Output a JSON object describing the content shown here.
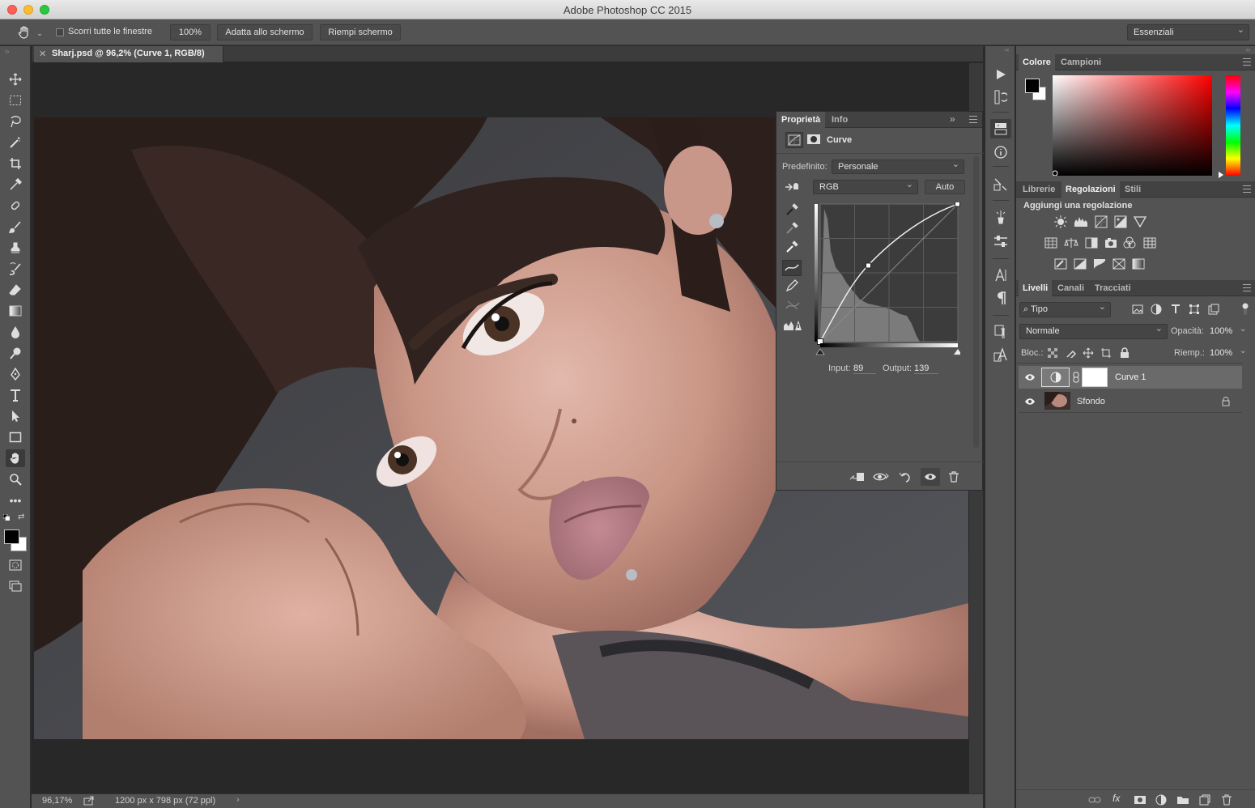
{
  "window": {
    "title": "Adobe Photoshop CC 2015"
  },
  "options_bar": {
    "scroll_all_label": "Scorri tutte le finestre",
    "zoom_btn": "100%",
    "fit_btn": "Adatta allo schermo",
    "fill_btn": "Riempi schermo",
    "workspace": "Essenziali"
  },
  "document": {
    "tab_title": "Sharj.psd @ 96,2% (Curve 1, RGB/8)"
  },
  "status": {
    "zoom": "96,17%",
    "size": "1200 px x 798 px (72 ppl)"
  },
  "properties": {
    "tab_active": "Proprietà",
    "tab_other": "Info",
    "type_label": "Curve",
    "preset_label": "Predefinito:",
    "preset_value": "Personale",
    "channel": "RGB",
    "auto_button": "Auto",
    "input_label": "Input:",
    "input_value": "89",
    "output_label": "Output:",
    "output_value": "139"
  },
  "color_panel": {
    "tabs": [
      "Colore",
      "Campioni"
    ]
  },
  "adjust_panel": {
    "tabs": [
      "Librerie",
      "Regolazioni",
      "Stili"
    ],
    "heading": "Aggiungi una regolazione"
  },
  "layers_panel": {
    "tabs": [
      "Livelli",
      "Canali",
      "Tracciati"
    ],
    "filter": "Tipo",
    "blend_mode": "Normale",
    "opacity_label": "Opacità:",
    "opacity_value": "100%",
    "lock_label": "Bloc.:",
    "fill_label": "Riemp.:",
    "fill_value": "100%",
    "layers": [
      {
        "name": "Curve 1"
      },
      {
        "name": "Sfondo"
      }
    ]
  },
  "colors": {
    "accent_active_tab": "#535353",
    "panel_bg": "#535353",
    "canvas_bg": "#282828"
  }
}
